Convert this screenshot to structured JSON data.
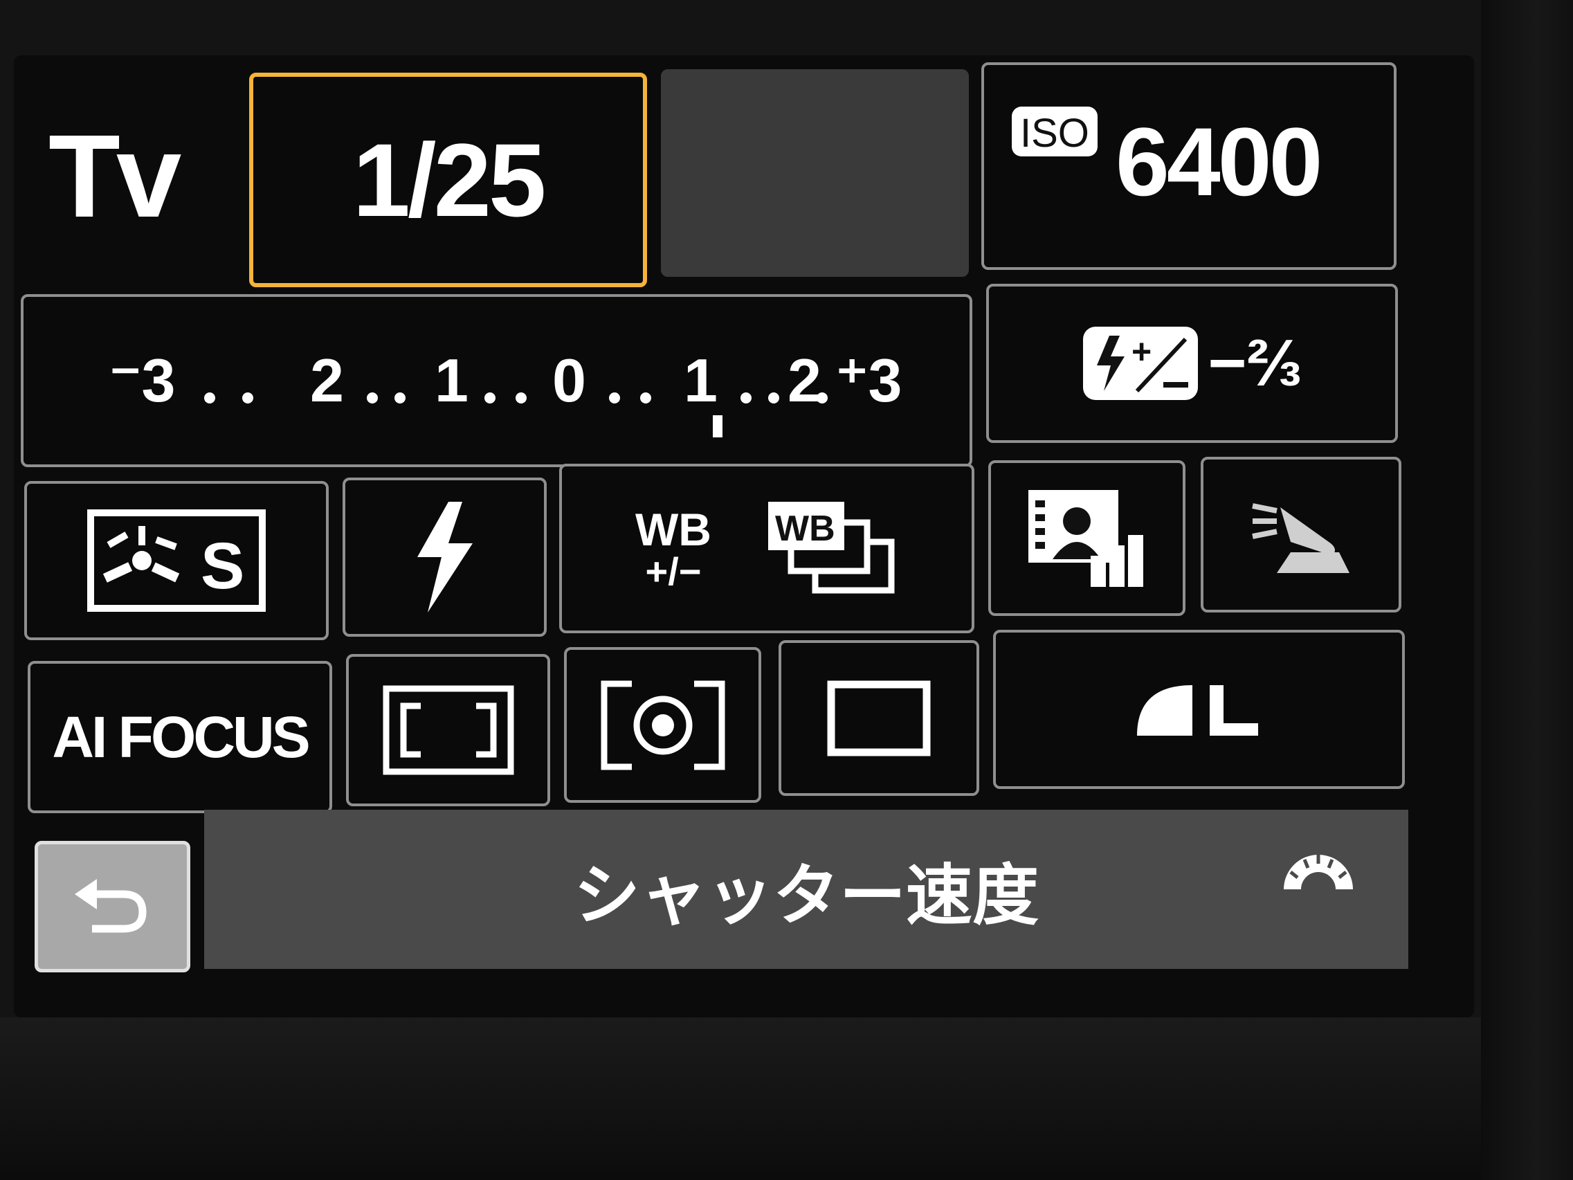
{
  "mode": "Tv",
  "shutter_speed": "1/25",
  "iso": {
    "label": "ISO",
    "value": "6400"
  },
  "exposure_scale": {
    "text": "-3..2..1..0..1..2..+3",
    "markers": [
      "⁻3",
      "2",
      "1",
      "0",
      "1",
      "2",
      "⁺3"
    ]
  },
  "flash_exposure_comp": {
    "value": "−⅔"
  },
  "wb_shift_label": {
    "top": "WB",
    "bottom": "+/−"
  },
  "af_mode": "AI FOCUS",
  "help": {
    "text": "シャッター速度"
  },
  "icons": {
    "picture_style": "picture-style-standard-icon",
    "flash": "flash-icon",
    "wb_shift": "wb-shift-icon",
    "wb_bracket": "wb-bracket-icon",
    "auto_lighting": "auto-lighting-optimizer-icon",
    "highlight_tone": "highlight-tone-priority-icon",
    "metering_evaluative": "evaluative-metering-icon",
    "metering_spot": "partial-metering-icon",
    "drive_single": "single-shot-icon",
    "quality": "image-quality-large-fine-icon",
    "back": "return-icon",
    "dial": "main-dial-icon"
  },
  "colors": {
    "selected_border": "#f4b43a",
    "cell_border": "#8f8f8f",
    "help_bar": "#4a4a4a"
  }
}
